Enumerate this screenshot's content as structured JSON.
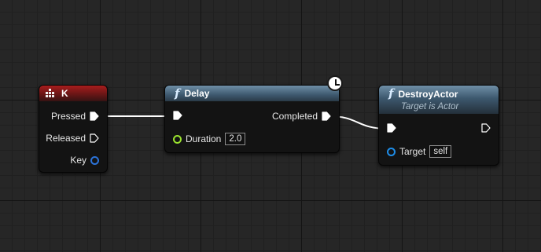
{
  "nodes": {
    "key_event": {
      "title": "K",
      "pins": {
        "pressed": "Pressed",
        "released": "Released",
        "key": "Key"
      }
    },
    "delay": {
      "title": "Delay",
      "pins": {
        "completed": "Completed",
        "duration": "Duration"
      },
      "duration_value": "2.0"
    },
    "destroy_actor": {
      "title": "DestroyActor",
      "subtitle": "Target is Actor",
      "pins": {
        "target": "Target"
      },
      "target_value": "self"
    }
  },
  "icons": {
    "function": "f",
    "keyboard": "keyboard-icon",
    "latent": "clock-icon"
  },
  "colors": {
    "event_header": "#8f1c1c",
    "function_header": "#4a6a82",
    "float_pin": "#9ae22f",
    "object_pin": "#1e8de8",
    "struct_pin": "#2c73d9",
    "exec_wire": "#ffffff"
  }
}
